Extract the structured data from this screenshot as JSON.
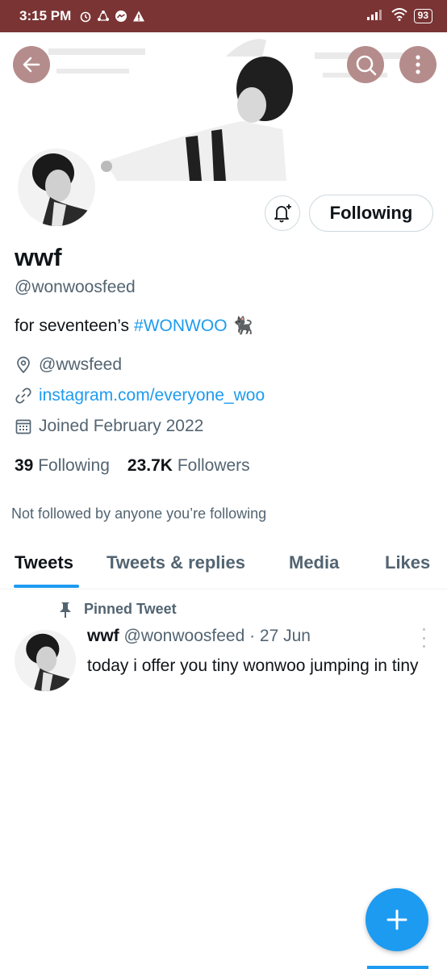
{
  "status_bar": {
    "time": "3:15 PM",
    "battery": "93",
    "icons_left": [
      "alarm-icon",
      "sync-icon",
      "messenger-icon",
      "warning-icon"
    ],
    "icons_right": [
      "signal-icon",
      "wifi-icon",
      "battery-icon"
    ]
  },
  "header": {
    "back_icon": "arrow-left-icon",
    "search_icon": "search-icon",
    "more_icon": "more-vertical-icon"
  },
  "profile": {
    "display_name": "wwf",
    "handle": "@wonwoosfeed",
    "bio_prefix": "for seventeen’s",
    "bio_hashtag": "#WONWOO",
    "bio_emoji": "🐈‍⬛",
    "location": "@wwsfeed",
    "website": "instagram.com/everyone_woo",
    "joined": "Joined February 2022",
    "following_count": "39",
    "following_label": "Following",
    "followers_count": "23.7K",
    "followers_label": "Followers",
    "not_followed": "Not followed by anyone you’re following",
    "follow_button": "Following"
  },
  "tabs": [
    {
      "label": "Tweets",
      "active": true
    },
    {
      "label": "Tweets & replies",
      "active": false
    },
    {
      "label": "Media",
      "active": false
    },
    {
      "label": "Likes",
      "active": false
    }
  ],
  "pinned_tweet": {
    "pinned_label": "Pinned Tweet",
    "name": "wwf",
    "handle_date": "@wonwoosfeed · 27 Jun",
    "text": "today i offer you tiny wonwoo jumping in tiny"
  },
  "colors": {
    "accent": "#1d9bf0",
    "status_bar": "#7a3434",
    "header_button": "#b58c8c",
    "secondary_text": "#536471"
  }
}
